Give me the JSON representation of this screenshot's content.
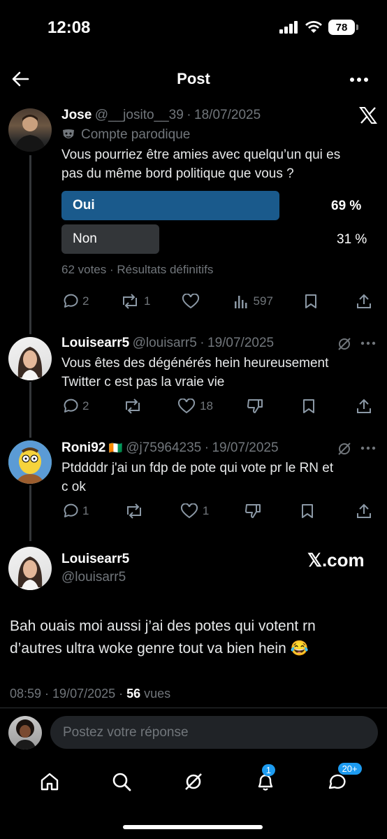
{
  "status": {
    "time": "12:08",
    "battery": "78"
  },
  "header": {
    "title": "Post"
  },
  "post": {
    "name": "Jose",
    "handle": "@__josito__39",
    "date": "18/07/2025",
    "label": "Compte parodique",
    "text_line1": "Vous pourriez être amies avec quelqu’un qui es",
    "text_line2": "pas du même bord politique que vous ?",
    "poll": [
      {
        "label": "Oui",
        "percent": "69 %",
        "value": 69
      },
      {
        "label": "Non",
        "percent": "31 %",
        "value": 31
      }
    ],
    "poll_meta": "62 votes · Résultats définitifs",
    "replies": "2",
    "reposts": "1",
    "views": "597"
  },
  "comments": [
    {
      "name": "Louisearr5",
      "handle": "@louisarr5",
      "date": "19/07/2025",
      "line1": "Vous êtes des dégénérés hein heureusement",
      "line2": "Twitter c est pas la vraie vie",
      "replies": "2",
      "likes": "18"
    },
    {
      "name": "Roni92",
      "flag": "🇨🇮",
      "handle": "@j75964235",
      "date": "19/07/2025",
      "line1": "Ptddddr j'ai un fdp de pote qui vote pr le RN et",
      "line2": "c ok",
      "replies": "1",
      "likes": "1"
    }
  ],
  "quoted": {
    "name": "Louisearr5",
    "handle": "@louisarr5",
    "brand": "𝕏.com",
    "line1": "Bah ouais moi aussi j’ai des potes qui votent rn",
    "line2": "d’autres ultra woke genre tout va bien hein 😂",
    "timestamp": "08:59 · 19/07/2025 · ",
    "views_count": "56",
    "views_label": " vues"
  },
  "reply_box": {
    "placeholder": "Postez votre réponse"
  },
  "tabbar": {
    "notifications_badge": "1",
    "messages_badge": "20+"
  },
  "colors": {
    "accent": "#1d9bf0",
    "poll_winner": "#1a5a8c",
    "poll_other": "#333639"
  }
}
